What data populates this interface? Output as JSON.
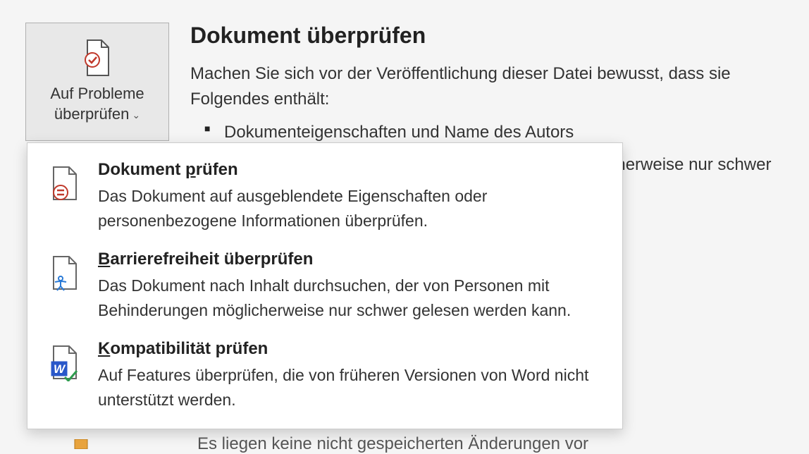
{
  "button": {
    "line1": "Auf Probleme",
    "line2": "überprüfen"
  },
  "main": {
    "title": "Dokument überprüfen",
    "desc": "Machen Sie sich vor der Veröffentlichung dieser Datei bewusst, dass sie Folgendes enthält:",
    "bullets": [
      "Dokumenteigenschaften und Name des Autors",
      "Inhalte, die von Personen mit Behinderungen möglicherweise nur schwer"
    ]
  },
  "menu": {
    "items": [
      {
        "title_pre": "Dokument ",
        "title_ul": "p",
        "title_post": "rüfen",
        "desc": "Das Dokument auf ausgeblendete Eigenschaften oder personenbezogene Informationen überprüfen."
      },
      {
        "title_pre": "",
        "title_ul": "B",
        "title_post": "arrierefreiheit überprüfen",
        "desc": "Das Dokument nach Inhalt durchsuchen, der von Personen mit Behinderungen möglicherweise nur schwer gelesen werden kann."
      },
      {
        "title_pre": "",
        "title_ul": "K",
        "title_post": "ompatibilität prüfen",
        "desc": "Auf Features überprüfen, die von früheren Versionen von Word nicht unterstützt werden."
      }
    ]
  },
  "below": {
    "text": "Es liegen keine nicht gespeicherten Änderungen vor"
  }
}
